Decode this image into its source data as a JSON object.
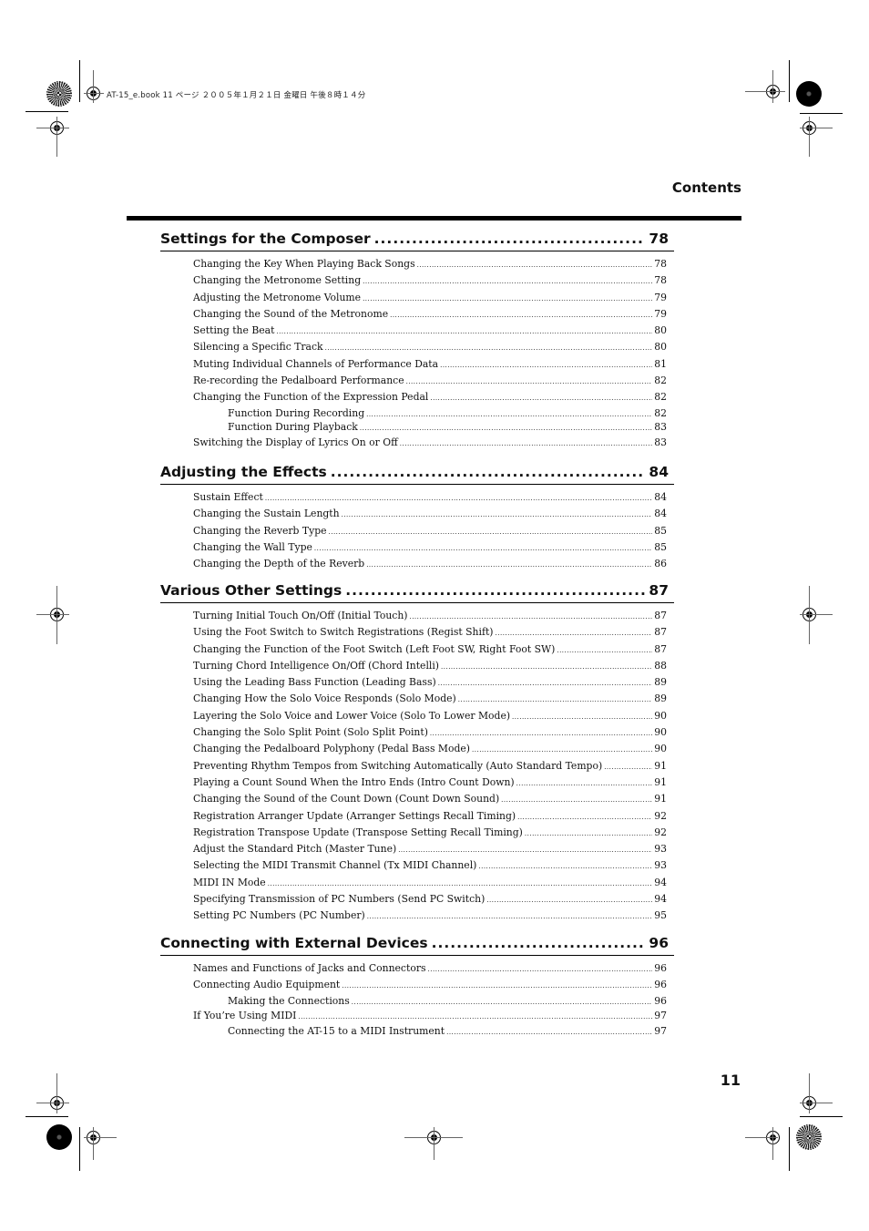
{
  "print_header": "AT-15_e.book  11 ページ  ２００５年１月２１日  金曜日  午後８時１４分",
  "running_title": "Contents",
  "page_number": "11",
  "sections": [
    {
      "title": "Settings for the Composer",
      "page": "78",
      "entries": [
        {
          "title": "Changing the Key When Playing Back Songs",
          "page": "78",
          "level": 1
        },
        {
          "title": "Changing the Metronome Setting",
          "page": "78",
          "level": 1
        },
        {
          "title": "Adjusting the Metronome Volume",
          "page": "79",
          "level": 1
        },
        {
          "title": "Changing the Sound of the Metronome",
          "page": "79",
          "level": 1
        },
        {
          "title": "Setting the Beat",
          "page": "80",
          "level": 1
        },
        {
          "title": "Silencing a Specific Track",
          "page": "80",
          "level": 1
        },
        {
          "title": "Muting Individual Channels of Performance Data",
          "page": "81",
          "level": 1
        },
        {
          "title": "Re-recording the Pedalboard Performance",
          "page": "82",
          "level": 1
        },
        {
          "title": "Changing the Function of the Expression Pedal",
          "page": "82",
          "level": 1
        },
        {
          "title": "Function During Recording",
          "page": "82",
          "level": 2
        },
        {
          "title": "Function During Playback",
          "page": "83",
          "level": 2
        },
        {
          "title": "Switching the Display of Lyrics On or Off",
          "page": "83",
          "level": 1
        }
      ]
    },
    {
      "title": "Adjusting the Effects",
      "page": "84",
      "entries": [
        {
          "title": "Sustain Effect",
          "page": "84",
          "level": 1
        },
        {
          "title": "Changing the Sustain Length",
          "page": "84",
          "level": 1
        },
        {
          "title": "Changing the Reverb Type",
          "page": "85",
          "level": 1
        },
        {
          "title": "Changing the Wall Type",
          "page": "85",
          "level": 1
        },
        {
          "title": "Changing the Depth of the Reverb",
          "page": "86",
          "level": 1
        }
      ]
    },
    {
      "title": "Various Other Settings",
      "page": "87",
      "entries": [
        {
          "title": "Turning Initial Touch On/Off (Initial Touch)",
          "page": "87",
          "level": 1
        },
        {
          "title": "Using the Foot Switch to Switch Registrations (Regist Shift)",
          "page": "87",
          "level": 1
        },
        {
          "title": "Changing the Function of the Foot Switch (Left Foot SW, Right Foot SW)",
          "page": "87",
          "level": 1
        },
        {
          "title": "Turning Chord Intelligence On/Off (Chord Intelli)",
          "page": "88",
          "level": 1
        },
        {
          "title": "Using the Leading Bass Function (Leading Bass)",
          "page": "89",
          "level": 1
        },
        {
          "title": "Changing How the Solo Voice Responds (Solo Mode)",
          "page": "89",
          "level": 1
        },
        {
          "title": "Layering the Solo Voice and Lower Voice (Solo To Lower Mode)",
          "page": "90",
          "level": 1
        },
        {
          "title": "Changing the Solo Split Point (Solo Split Point)",
          "page": "90",
          "level": 1
        },
        {
          "title": "Changing the Pedalboard Polyphony (Pedal Bass Mode)",
          "page": "90",
          "level": 1
        },
        {
          "title": "Preventing Rhythm Tempos from Switching Automatically (Auto Standard Tempo)",
          "page": "91",
          "level": 1
        },
        {
          "title": "Playing a Count Sound When the Intro Ends (Intro Count Down)",
          "page": "91",
          "level": 1
        },
        {
          "title": "Changing the Sound of the Count Down (Count Down Sound)",
          "page": "91",
          "level": 1
        },
        {
          "title": "Registration Arranger Update (Arranger Settings Recall Timing)",
          "page": "92",
          "level": 1
        },
        {
          "title": "Registration Transpose Update (Transpose Setting Recall Timing)",
          "page": "92",
          "level": 1
        },
        {
          "title": "Adjust the Standard Pitch (Master Tune)",
          "page": "93",
          "level": 1
        },
        {
          "title": "Selecting the MIDI Transmit Channel (Tx MIDI Channel)",
          "page": "93",
          "level": 1
        },
        {
          "title": "MIDI IN Mode",
          "page": "94",
          "level": 1
        },
        {
          "title": "Specifying Transmission of PC Numbers (Send PC Switch)",
          "page": "94",
          "level": 1
        },
        {
          "title": "Setting PC Numbers (PC Number)",
          "page": "95",
          "level": 1
        }
      ]
    },
    {
      "title": "Connecting with External Devices",
      "page": "96",
      "entries": [
        {
          "title": "Names and Functions of Jacks and Connectors",
          "page": "96",
          "level": 1
        },
        {
          "title": "Connecting Audio Equipment",
          "page": "96",
          "level": 1
        },
        {
          "title": "Making the Connections",
          "page": "96",
          "level": 2
        },
        {
          "title": "If You’re Using MIDI",
          "page": "97",
          "level": 1
        },
        {
          "title": "Connecting the AT-15 to a MIDI Instrument",
          "page": "97",
          "level": 2
        }
      ]
    }
  ]
}
